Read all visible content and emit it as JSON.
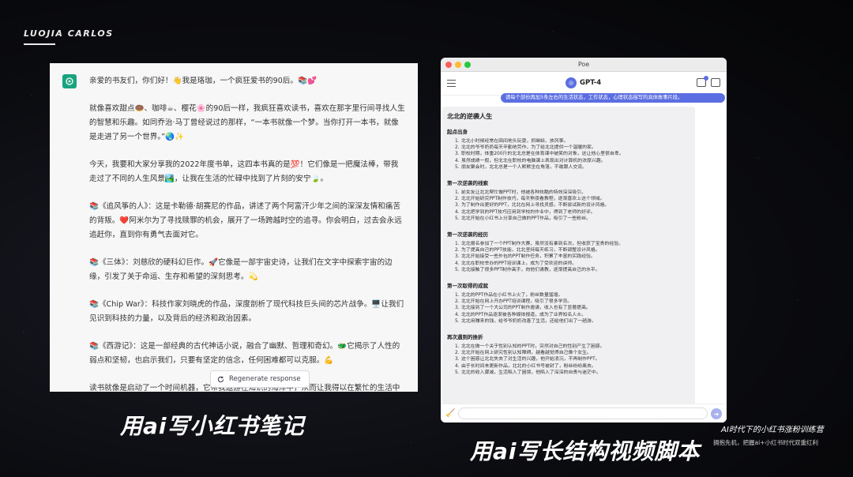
{
  "brand": "LUOJIA CARLOS",
  "chat": {
    "paragraphs": [
      "亲爱的书友们，你们好！👋我是珞珈，一个疯狂爱书的90后。📚💕",
      "就像喜欢甜点🍩、咖啡☕、樱花🌸的90后一样，我疯狂喜欢读书，喜欢在那字里行间寻找人生的智慧和乐趣。如同乔治·马丁曾经说过的那样，“一本书就像一个梦。当你打开一本书，就像是走进了另一个世界。”🌏✨",
      "今天，我要和大家分享我的2022年度书单，这四本书真的是💯！它们像是一把魔法棒，带我走过了不同的人生风景🏞️，让我在生活的忙碌中找到了片刻的安宁🍃。",
      "📚《追风筝的人》：这是卡勒德·胡赛尼的作品，讲述了两个阿富汗少年之间的深深友情和痛苦的背叛。❤️阿米尔为了寻找赎罪的机会，展开了一场跨越时空的追寻。你会明白，过去会永远追赶你，直到你有勇气去面对它。",
      "📚《三体》：刘慈欣的硬科幻巨作。🚀它像是一部宇宙史诗，让我们在文字中探索宇宙的边缘，引发了关于命运、生存和希望的深刻思考。💫",
      "📚《Chip War》：科技作家刘晓虎的作品，深度剖析了现代科技巨头间的芯片战争。🖥️让我们见识到科技的力量，以及背后的经济和政治因素。",
      "📚《西游记》：这是一部经典的古代神话小说，融合了幽默、哲理和奇幻。🐲它揭示了人性的弱点和坚韧，也启示我们，只要有坚定的信念，任何困难都可以克服。💪",
      "读书就像是启动了一个时间机器，它带我遨游在知识的海洋中，从而让我得以在繁忙的生活中找到片刻的宁静。🕰️🌊希望我的分享能对你们有所启发，让你们在阅读的过程中找到属于自己的乐趣。🎈"
    ],
    "regenerate_label": "Regenerate response"
  },
  "captions": {
    "left": "用ai写小红书笔记",
    "right": "用ai写长结构视频脚本"
  },
  "promo": {
    "title": "AI时代下的小红书涨粉训练营",
    "subtitle": "拥抱先机，把握ai+小红书时代双重红利"
  },
  "poe": {
    "window_title": "Poe",
    "bot_name": "GPT-4",
    "user_message": "请每个部份再加5条左右的生活状态，工作状态，心理状态描写的具体故事片段。",
    "doc_title": "北北的逆袭人生",
    "sections": [
      {
        "title": "起点出身",
        "items": [
          "北北小时候经常在田间地头玩耍，抓蝌蚪、放风筝。",
          "北北的爷爷奶奶每天辛勤地劳作，为了给北北提供一个温暖的家。",
          "职校时期，体重200斤的北北总是在体育课中被笑的对象，这让他心里很自卑。",
          "虽然成绩一般，但北北在职校的电脑课上表现出对计算机的浓厚兴趣。",
          "朋友聚会时，北北总是一个人默默坐在角落，不敢跟人交流。"
        ]
      },
      {
        "title": "第一次逆袭的线索",
        "items": [
          "前女友让北北帮忙做PPT时，他被各种炫酷的特效深深吸引。",
          "北北开始研究PPT制作技巧，每天熬夜看教程，逐渐喜欢上这个领域。",
          "为了制作出更好的PPT，北北在网上寻找灵感，不断尝试新的设计风格。",
          "北北把学到的PPT技巧应用到学校的作业中，得到了老师的好评。",
          "北北开始在小红书上分享自己做的PPT作品，吸引了一些粉丝。"
        ]
      },
      {
        "title": "第一次逆袭的经历",
        "items": [
          "北北报名参加了一个PPT制作大赛，虽然没有拿到名次，但收获了宝贵的经验。",
          "为了提高自己的PPT技能，北北坚持每天练习，不断调整设计风格。",
          "北北开始接受一些外包的PPT制作任务，积累了丰富的实践经验。",
          "北北在职校举办的PPT培训课上，成为了受欢迎的讲师。",
          "北北接触了很多PPT制作高手，向他们请教，逐渐提高自己的水平。"
        ]
      },
      {
        "title": "第一次取得的成就",
        "items": [
          "北北的PPT作品在小红书上火了，粉丝数量猛增。",
          "北北开始在网上开办PPT培训课程，吸引了很多学员。",
          "北北接到了一个大公司的PPT制作邀请，收入也有了显著提高。",
          "北北的PPT作品逐渐被各种媒体报道，成为了业界知名人士。",
          "北北用赚来的钱，给爷爷奶奶改善了生活，还给他们出了一趟游。"
        ]
      },
      {
        "title": "再次遇到的挫折",
        "items": [
          "北北在做一个关于性别认知的PPT时，突然对自己的性别产生了困惑。",
          "北北开始在网上研究性别认知障碍，越看越觉得自己像个女生。",
          "这个困惑让北北失去了对生活的兴趣，他开始消沉，不再制作PPT。",
          "由于长时间未更新作品，北北的小红书号被封了，粉丝纷纷离去。",
          "北北的收入骤减，生活陷入了困境，他陷入了深深的自责与迷茫中。"
        ]
      }
    ]
  }
}
